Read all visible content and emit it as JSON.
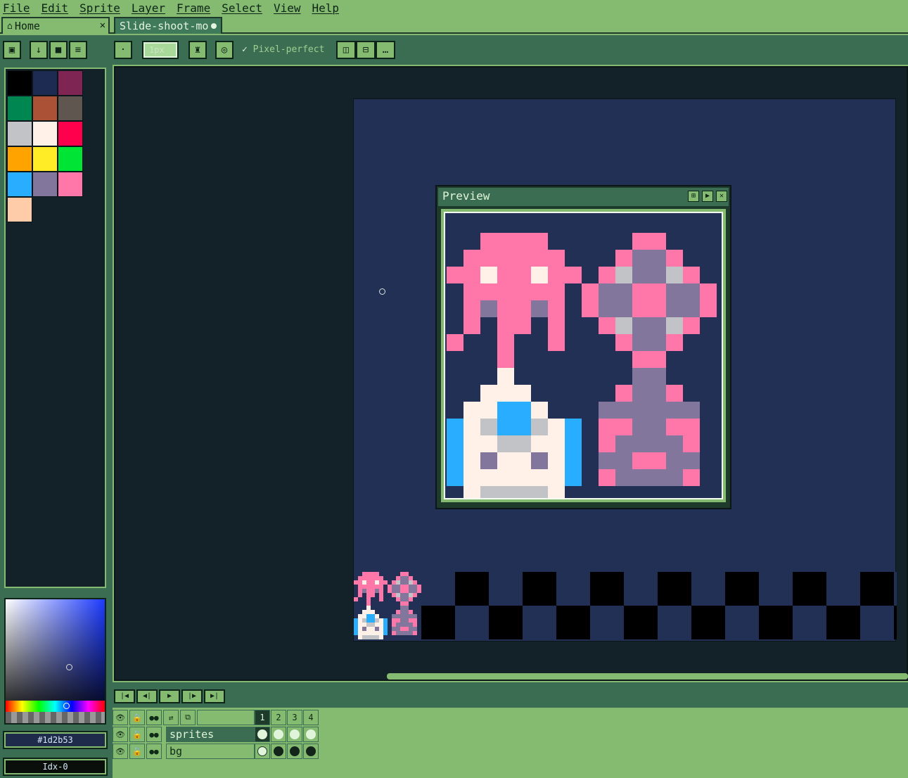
{
  "menu": [
    "File",
    "Edit",
    "Sprite",
    "Layer",
    "Frame",
    "Select",
    "View",
    "Help"
  ],
  "tabs": [
    {
      "label": "Home",
      "close": "✕"
    },
    {
      "label": "Slide-shoot-mo",
      "modified": true
    }
  ],
  "toolbar": {
    "brush_size": "1px",
    "pixel_perfect_label": "Pixel-perfect",
    "pixel_perfect_checked": true
  },
  "palette": {
    "colors": [
      "#000000",
      "#1d2b53",
      "#7e2553",
      "#008751",
      "#ab5236",
      "#5f574f",
      "#c2c3c7",
      "#fff1e8",
      "#ff004d",
      "#ffa300",
      "#ffec27",
      "#00e436",
      "#29adff",
      "#83769c",
      "#ff77a8",
      "#ffccaa"
    ]
  },
  "color_picker": {
    "hex": "#1d2b53",
    "index": "Idx-0"
  },
  "preview": {
    "title": "Preview"
  },
  "timeline": {
    "frames": [
      "1",
      "2",
      "3",
      "4"
    ],
    "layers": [
      {
        "name": "sprites",
        "cels": [
          "filled",
          "filled",
          "filled",
          "filled"
        ]
      },
      {
        "name": "bg",
        "cels": [
          "filled",
          "dark",
          "dark",
          "dark"
        ]
      }
    ]
  },
  "icons": {
    "home": "house-icon",
    "close": "close-icon",
    "lock": "lock-icon",
    "eye": "eye-icon"
  },
  "colors": {
    "ui_green": "#84bb71",
    "ui_dark_green": "#3b6d52",
    "canvas_bg": "#213054",
    "workspace_bg": "#132229"
  }
}
